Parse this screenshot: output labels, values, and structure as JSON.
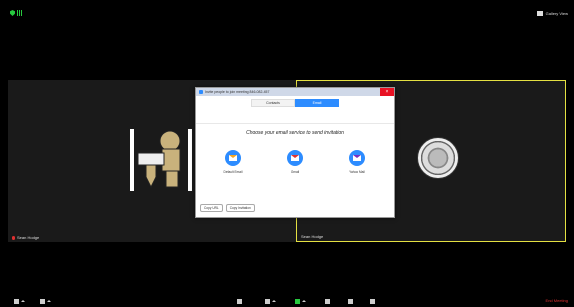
{
  "top": {
    "view_label": "Gallery View"
  },
  "participants": {
    "left_name": "Sean Hodge",
    "right_name": "Sean Hodge"
  },
  "dialog": {
    "title": "Invite people to join meeting 846-082-457",
    "tabs": [
      {
        "label": "Contacts"
      },
      {
        "label": "Email"
      }
    ],
    "heading": "Choose your email service to send invitation",
    "services": [
      {
        "label": "Default Email"
      },
      {
        "label": "Gmail"
      },
      {
        "label": "Yahoo Mail"
      }
    ],
    "copy_url": "Copy URL",
    "copy_invitation": "Copy Invitation"
  },
  "toolbar": {
    "end_label": "End Meeting"
  },
  "colors": {
    "accent": "#2d8cff",
    "active_speaker": "#e4e042",
    "end": "#e03030"
  }
}
